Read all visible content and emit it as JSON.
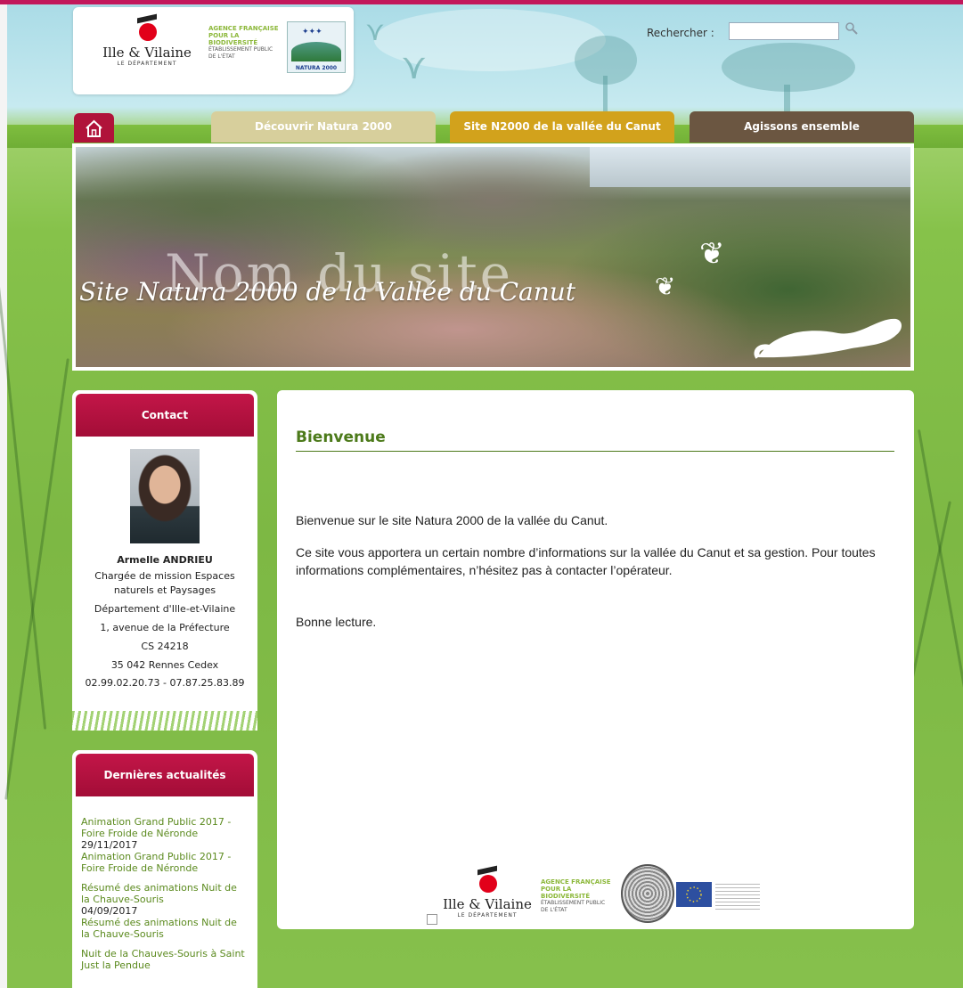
{
  "logos": {
    "ille_name": "Ille & Vilaine",
    "ille_sub": "LE DÉPARTEMENT",
    "afb_line1": "AGENCE FRANÇAISE",
    "afb_line2": "POUR LA BIODIVERSITÉ",
    "afb_line3": "ÉTABLISSEMENT PUBLIC DE L'ÉTAT",
    "n2000_label": "NATURA 2000"
  },
  "search": {
    "label": "Rechercher :",
    "value": ""
  },
  "nav": {
    "home_label": "",
    "tabs": [
      {
        "label": "Découvrir Natura 2000",
        "color": "#d7cf9c"
      },
      {
        "label": "Site N2000 de la vallée du Canut",
        "color": "#d2a21c"
      },
      {
        "label": "Agissons ensemble",
        "color": "#6b5641"
      }
    ]
  },
  "banner": {
    "overlay_title": "Nom du site",
    "script_title": "Site Natura 2000 de la Vallée du Canut"
  },
  "contact": {
    "heading": "Contact",
    "name": "Armelle ANDRIEU",
    "role": "Chargée de mission Espaces naturels et Paysages",
    "org": "Département d'Ille-et-Vilaine",
    "address": "1, avenue de la Préfecture",
    "cs": "CS 24218",
    "city": "35 042 Rennes Cedex",
    "phone": "02.99.02.20.73 - 07.87.25.83.89"
  },
  "news": {
    "heading": "Dernières actualités",
    "items": [
      {
        "title": "Animation Grand Public 2017 - Foire Froide de Néronde",
        "date": "29/11/2017",
        "desc": "Animation Grand Public 2017 - Foire Froide de Néronde"
      },
      {
        "title": "Résumé des animations Nuit de la Chauve-Souris",
        "date": "04/09/2017",
        "desc": "Résumé des animations Nuit de la Chauve-Souris"
      },
      {
        "title": "Nuit de la Chauves-Souris à Saint Just la Pendue",
        "date": "",
        "desc": ""
      }
    ]
  },
  "main": {
    "heading": "Bienvenue",
    "p1": "Bienvenue sur le site Natura 2000 de la vallée du Canut.",
    "p2": "Ce site vous apportera un certain nombre d’informations sur la vallée du Canut et sa gestion. Pour toutes informations complémentaires, n’hésitez pas à contacter l’opérateur.",
    "p3": "Bonne lecture."
  },
  "colors": {
    "accent": "#c2185b",
    "box_header": "#b0133a",
    "heading_green": "#4c7a1a"
  }
}
